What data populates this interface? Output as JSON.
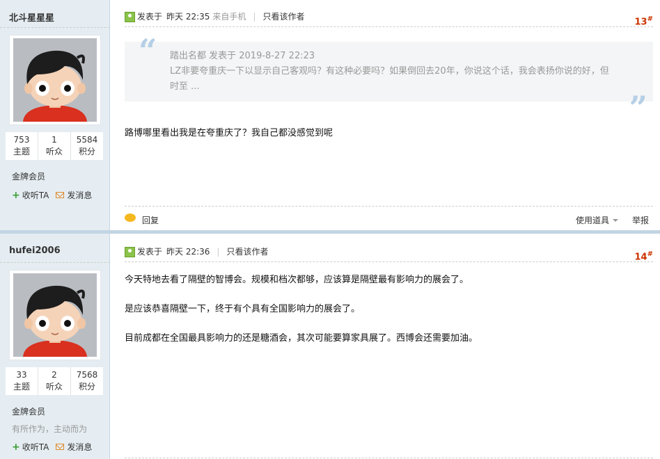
{
  "posts": [
    {
      "author": "北斗星星星",
      "stats": [
        {
          "value": "753",
          "label": "主题"
        },
        {
          "value": "1",
          "label": "听众"
        },
        {
          "value": "5584",
          "label": "积分"
        }
      ],
      "group": "金牌会员",
      "signature": "",
      "follow_label": "收听TA",
      "message_label": "发消息",
      "posted_label": "发表于",
      "time": "昨天 22:35",
      "source": "来自手机",
      "only_author_label": "只看该作者",
      "floor": "13",
      "floor_suffix": "#",
      "quote": {
        "meta": "踏出名都 发表于 2019-8-27 22:23",
        "text": "LZ非要夸重庆一下以显示自己客观吗？有这种必要吗？如果倒回去20年，你说这个话，我会表扬你说的好，但时至 ..."
      },
      "paragraphs": [
        "路博哪里看出我是在夸重庆了？我自己都没感觉到呢"
      ],
      "reply_label": "回复",
      "tools_label": "使用道具",
      "report_label": "举报"
    },
    {
      "author": "hufei2006",
      "stats": [
        {
          "value": "33",
          "label": "主题"
        },
        {
          "value": "2",
          "label": "听众"
        },
        {
          "value": "7568",
          "label": "积分"
        }
      ],
      "group": "金牌会员",
      "signature": "有所作为，主动而为",
      "follow_label": "收听TA",
      "message_label": "发消息",
      "posted_label": "发表于",
      "time": "昨天 22:36",
      "source": "",
      "only_author_label": "只看该作者",
      "floor": "14",
      "floor_suffix": "#",
      "paragraphs": [
        "今天特地去看了隔壁的智博会。规模和档次都够，应该算是隔壁最有影响力的展会了。",
        "是应该恭喜隔壁一下，终于有个具有全国影响力的展会了。",
        "目前成都在全国最具影响力的还是糖酒会，其次可能要算家具展了。西博会还需要加油。"
      ]
    }
  ]
}
